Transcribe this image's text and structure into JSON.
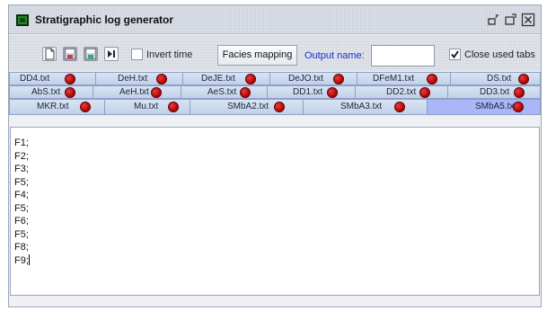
{
  "window": {
    "title": "Stratigraphic log generator"
  },
  "toolbar": {
    "icons": [
      "new-file-icon",
      "save-icon",
      "save-as-icon",
      "play-step-icon"
    ],
    "invert_time": {
      "label": "Invert time",
      "checked": false
    },
    "facies_button": "Facies mapping",
    "output_label": "Output name:",
    "output_value": "",
    "close_tabs": {
      "label": "Close used tabs",
      "checked": true
    }
  },
  "tabs": {
    "row1": [
      "DD4.txt",
      "DeH.txt",
      "DeJE.txt",
      "DeJO.txt",
      "DFeM1.txt",
      "DS.txt"
    ],
    "row2": [
      "AbS.txt",
      "AeH.txt",
      "AeS.txt",
      "DD1.txt",
      "DD2.txt",
      "DD3.txt"
    ],
    "row3": [
      "MKR.txt",
      "Mu.txt",
      "SMbA2.txt",
      "SMbA3.txt",
      "SMbA5.txt"
    ],
    "selected": "SMbA5.txt"
  },
  "editor": {
    "lines": [
      "F1;",
      "F2;",
      "F3;",
      "F5;",
      "F4;",
      "F5;",
      "F6;",
      "F5;",
      "F8;",
      "F9;"
    ]
  },
  "colors": {
    "tab_bg": "#c9d7ee",
    "tab_selected": "#a9b6f7",
    "close_dot": "#c00000",
    "output_label": "#1a2fd0"
  }
}
